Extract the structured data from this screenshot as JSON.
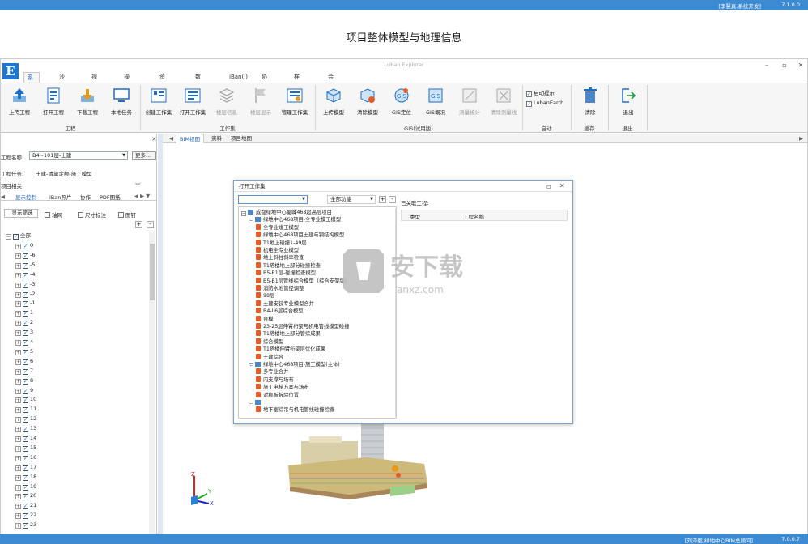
{
  "topbar": {
    "user": "[李慧真,系统开发]",
    "version": "7.1.0.0"
  },
  "page_title": "项目整体模型与地理信息",
  "window": {
    "title": "Luban Explorer",
    "logo": "E"
  },
  "menu_tabs": [
    {
      "label": "系统(S)",
      "active": true
    },
    {
      "label": "沙盘(X)"
    },
    {
      "label": "视图(V)"
    },
    {
      "label": "操作(O)"
    },
    {
      "label": "资料(M)"
    },
    {
      "label": "数据(D)"
    },
    {
      "label": "iBan(I)"
    },
    {
      "label": "协作(T)"
    },
    {
      "label": "样式(Y)"
    },
    {
      "label": "会员中心(C)"
    }
  ],
  "ribbon": {
    "buttons": [
      {
        "label": "上传工程",
        "icon": "upload-icon"
      },
      {
        "label": "打开工程",
        "icon": "open-project-icon"
      },
      {
        "label": "下载工程",
        "icon": "download-icon"
      },
      {
        "label": "本地任务",
        "icon": "monitor-icon"
      },
      {
        "label": "创建工作集",
        "icon": "create-set-icon"
      },
      {
        "label": "打开工作集",
        "icon": "open-set-icon"
      },
      {
        "label": "楼层信息",
        "icon": "floor-icon",
        "disabled": true
      },
      {
        "label": "楼层显示",
        "icon": "flag-icon",
        "disabled": true
      },
      {
        "label": "管理工作集",
        "icon": "manage-set-icon"
      },
      {
        "label": "上传模型",
        "icon": "upload-model-icon"
      },
      {
        "label": "清除模型",
        "icon": "clear-model-icon"
      },
      {
        "label": "GIS定位",
        "icon": "gis-locate-icon"
      },
      {
        "label": "GIS概况",
        "icon": "gis-overview-icon"
      },
      {
        "label": "测量统计",
        "icon": "measure-icon",
        "disabled": true
      },
      {
        "label": "清除测量线",
        "icon": "clear-measure-icon",
        "disabled": true
      },
      {
        "label": "清除",
        "icon": "trash-icon"
      },
      {
        "label": "退出",
        "icon": "exit-icon"
      }
    ],
    "groups": [
      "工程",
      "工作集",
      "GIS(试用版)",
      "启动",
      "缓存",
      "退出"
    ],
    "checks": [
      {
        "label": "启动提示",
        "checked": true
      },
      {
        "label": "LubanEarth",
        "checked": true
      }
    ]
  },
  "left": {
    "project_name_label": "工程名称:",
    "project_name_value": "B4~101层-土建",
    "more_button": "更多...",
    "task_label": "工程任务:",
    "task_value": "土建-清单定额-施工模型",
    "related": "项目相关",
    "tabs": [
      "显示控制",
      "iBan照片",
      "协作",
      "PDF图纸"
    ],
    "show_filter": "显示筛选",
    "checks": [
      "轴网",
      "尺寸标注",
      "图钉"
    ],
    "tree_root": "全部",
    "floors": [
      "0",
      "-6",
      "-5",
      "-4",
      "-3",
      "-2",
      "-1",
      "1",
      "2",
      "3",
      "4",
      "5",
      "6",
      "7",
      "8",
      "9",
      "10",
      "11",
      "12",
      "13",
      "14",
      "15",
      "16",
      "17",
      "18",
      "19",
      "20",
      "21",
      "22",
      "23"
    ]
  },
  "view_tabs": [
    "BIM视图",
    "资料",
    "项目地图"
  ],
  "dialog": {
    "title": "打开工作集",
    "filter_value": "",
    "function_select": "全部功能",
    "assoc_label": "已关联工程:",
    "columns": [
      "类型",
      "工程名称"
    ],
    "tree": [
      {
        "level": 0,
        "kind": "root",
        "label": "成都绿地中心蜀峰468超高层项目"
      },
      {
        "level": 1,
        "kind": "folder",
        "label": "绿地中心468项目-全专业模工模型"
      },
      {
        "level": 2,
        "kind": "file",
        "label": "全专业竣工模型"
      },
      {
        "level": 2,
        "kind": "file",
        "label": "绿地中心468项目土建与钢结构模型"
      },
      {
        "level": 2,
        "kind": "file",
        "label": "T1地上碰撞1-49层"
      },
      {
        "level": 2,
        "kind": "file",
        "label": "机电全专业模型"
      },
      {
        "level": 2,
        "kind": "file",
        "label": "地上斜柱斜率检查"
      },
      {
        "level": 2,
        "kind": "file",
        "label": "T1塔楼地上部分碰撞检查"
      },
      {
        "level": 2,
        "kind": "file",
        "label": "B5-B1层-碰撞检查模型"
      },
      {
        "level": 2,
        "kind": "file",
        "label": "B5-B1层管线综合模型（综合支架版）"
      },
      {
        "level": 2,
        "kind": "file",
        "label": "消防水池管径调整"
      },
      {
        "level": 2,
        "kind": "file",
        "label": "98层"
      },
      {
        "level": 2,
        "kind": "file",
        "label": "土建安装专业模型合并"
      },
      {
        "level": 2,
        "kind": "file",
        "label": "B4-L6层综合模型"
      },
      {
        "level": 2,
        "kind": "file",
        "label": "合模"
      },
      {
        "level": 2,
        "kind": "file",
        "label": "23-25层伸臂桁架与机电管线模型碰撞"
      },
      {
        "level": 2,
        "kind": "file",
        "label": "T1塔楼地上部分管综成果"
      },
      {
        "level": 2,
        "kind": "file",
        "label": "综合模型"
      },
      {
        "level": 2,
        "kind": "file",
        "label": "T1塔楼伸臂桁架层优化成果"
      },
      {
        "level": 2,
        "kind": "file",
        "label": "土建综合"
      },
      {
        "level": 1,
        "kind": "folder",
        "label": "绿地中心468项目-施工模型(主体)"
      },
      {
        "level": 2,
        "kind": "file",
        "label": "多专业合并"
      },
      {
        "level": 2,
        "kind": "file",
        "label": "内支撑与场布"
      },
      {
        "level": 2,
        "kind": "file",
        "label": "施工电梯方案与场布"
      },
      {
        "level": 2,
        "kind": "file",
        "label": "对称板拆除位置"
      },
      {
        "level": 1,
        "kind": "folder",
        "label": ""
      },
      {
        "level": 2,
        "kind": "file",
        "label": "地下室综吊与机电管线碰撞检查"
      }
    ]
  },
  "watermark": {
    "text": "安下载",
    "sub": "anxz.com"
  },
  "axes": {
    "x": "X",
    "y": "Y",
    "z": "Z"
  },
  "statusbar": {
    "user": "[刘泽毅,绿地中心BIM总顾问]",
    "version": "7.0.0.7"
  }
}
